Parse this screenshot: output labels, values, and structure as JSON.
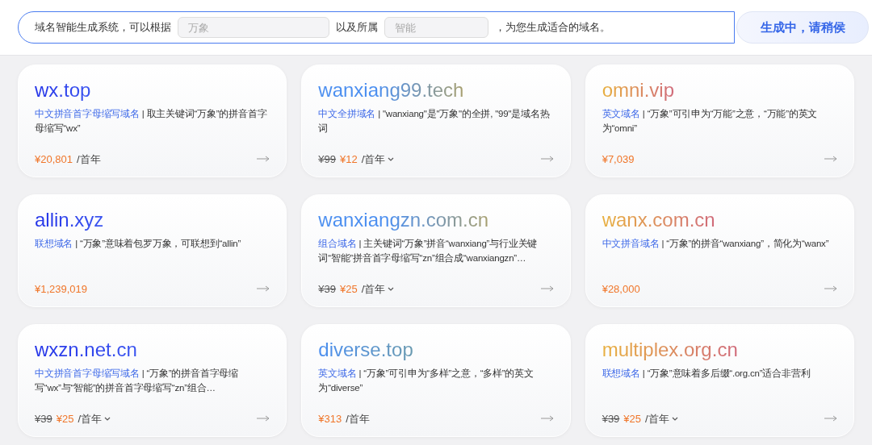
{
  "prompt": {
    "prefix": "域名智能生成系统，可以根据",
    "keyword_placeholder": "万象",
    "middle": "以及所属",
    "industry_placeholder": "智能",
    "suffix": "，为您生成适合的域名。",
    "button": "生成中，请稍侯"
  },
  "cards": [
    {
      "domain": "wx.top",
      "kind": "blue",
      "type": "中文拼音首字母缩写域名",
      "desc": "| 取主关键词“万象”的拼音首字母缩写“wx”",
      "price": "¥20,801",
      "unit": "/首年",
      "dropdown": false
    },
    {
      "domain": "wanxiang99.tech",
      "kind": "sage",
      "type": "中文全拼域名",
      "desc": "| \"wanxiang\"是\"万象\"的全拼, \"99\"是域名热词",
      "original_price": "¥99",
      "price": "¥12",
      "unit": "/首年",
      "dropdown": true
    },
    {
      "domain": "omni.vip",
      "kind": "amber",
      "type": "英文域名",
      "desc": "| “万象”可引申为“万能”之意，“万能”的英文为“omni”",
      "price": "¥7,039",
      "dropdown": false
    },
    {
      "domain": "allin.xyz",
      "kind": "blue",
      "type": "联想域名",
      "desc": "| “万象”意味着包罗万象，可联想到“allin”",
      "price": "¥1,239,019",
      "dropdown": false
    },
    {
      "domain": "wanxiangzn.com.cn",
      "kind": "sage",
      "type": "组合域名",
      "desc": "| 主关键词“万象”拼音“wanxiang”与行业关键词“智能”拼音首字母缩写“zn”组合成“wanxiangzn”…",
      "original_price": "¥39",
      "price": "¥25",
      "unit": "/首年",
      "dropdown": true
    },
    {
      "domain": "wanx.com.cn",
      "kind": "amber",
      "type": "中文拼音域名",
      "desc": "| “万象”的拼音“wanxiang”，简化为“wanx”",
      "price": "¥28,000",
      "dropdown": false
    },
    {
      "domain": "wxzn.net.cn",
      "kind": "blue",
      "type": "中文拼音首字母缩写域名",
      "desc": "| “万象”的拼音首字母缩写“wx”与“智能”的拼音首字母缩写“zn”组合…",
      "original_price": "¥39",
      "price": "¥25",
      "unit": "/首年",
      "dropdown": true
    },
    {
      "domain": "diverse.top",
      "kind": "sky",
      "type": "英文域名",
      "desc": "| “万象”可引申为“多样”之意，“多样”的英文为“diverse”",
      "price": "¥313",
      "unit": "/首年",
      "dropdown": false
    },
    {
      "domain": "multiplex.org.cn",
      "kind": "amber",
      "type": "联想域名",
      "desc": "| “万象”意味着多后缀“.org.cn”适合非营利",
      "original_price": "¥39",
      "price": "¥25",
      "unit": "/首年",
      "dropdown": true
    }
  ]
}
